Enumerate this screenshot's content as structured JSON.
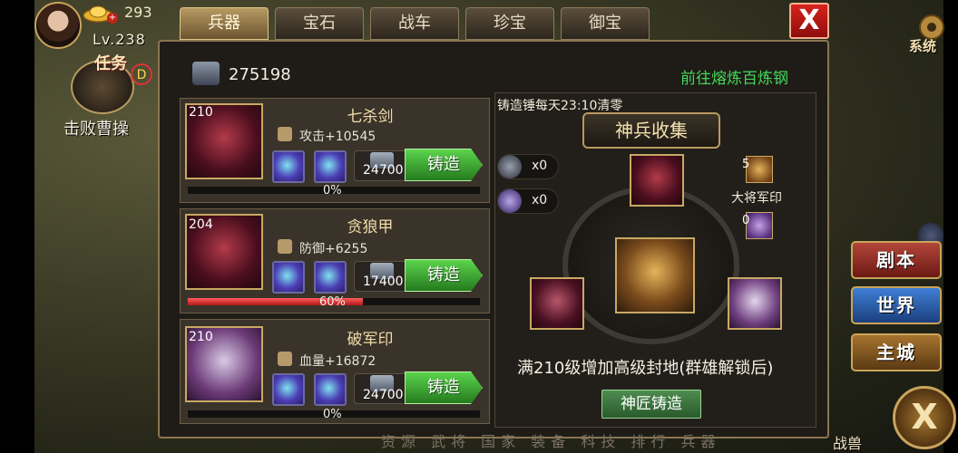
{
  "player": {
    "gold": "293",
    "level": "Lv.238",
    "gold_plus": "+"
  },
  "task": {
    "title": "任务",
    "label": "击败曹操",
    "badge": "D"
  },
  "tabs": [
    "兵器",
    "宝石",
    "战车",
    "珍宝",
    "御宝"
  ],
  "system_label": "系统",
  "close_label": "X",
  "steel": {
    "amount": "275198",
    "goto_link": "前往熔炼百炼钢"
  },
  "items": [
    {
      "level": "210",
      "name": "七杀剑",
      "stat": "攻击+10545",
      "cost": "24700",
      "forge": "铸造",
      "progress_pct": 0,
      "progress_label": "0%"
    },
    {
      "level": "204",
      "name": "贪狼甲",
      "stat": "防御+6255",
      "cost": "17400",
      "forge": "铸造",
      "progress_pct": 60,
      "progress_label": "60%"
    },
    {
      "level": "210",
      "name": "破军印",
      "stat": "血量+16872",
      "cost": "24700",
      "forge": "铸造",
      "progress_pct": 0,
      "progress_label": "0%"
    }
  ],
  "collection": {
    "reset_text": "铸造锤每天23:10清零",
    "title": "神兵收集",
    "hammer_counts": [
      "x0",
      "x0"
    ],
    "seal_top_count": "5",
    "seal_label": "大将军印",
    "seal_bottom_count": "0",
    "bonus_text": "满210级增加高级封地(群雄解锁后)",
    "master_button": "神匠铸造"
  },
  "side_menu": [
    "剧本",
    "世界",
    "主城"
  ],
  "bottom_close": "X",
  "beast_label": "战兽",
  "bottom_nav": "资源 武将 国家 装备 科技 排行 兵器"
}
